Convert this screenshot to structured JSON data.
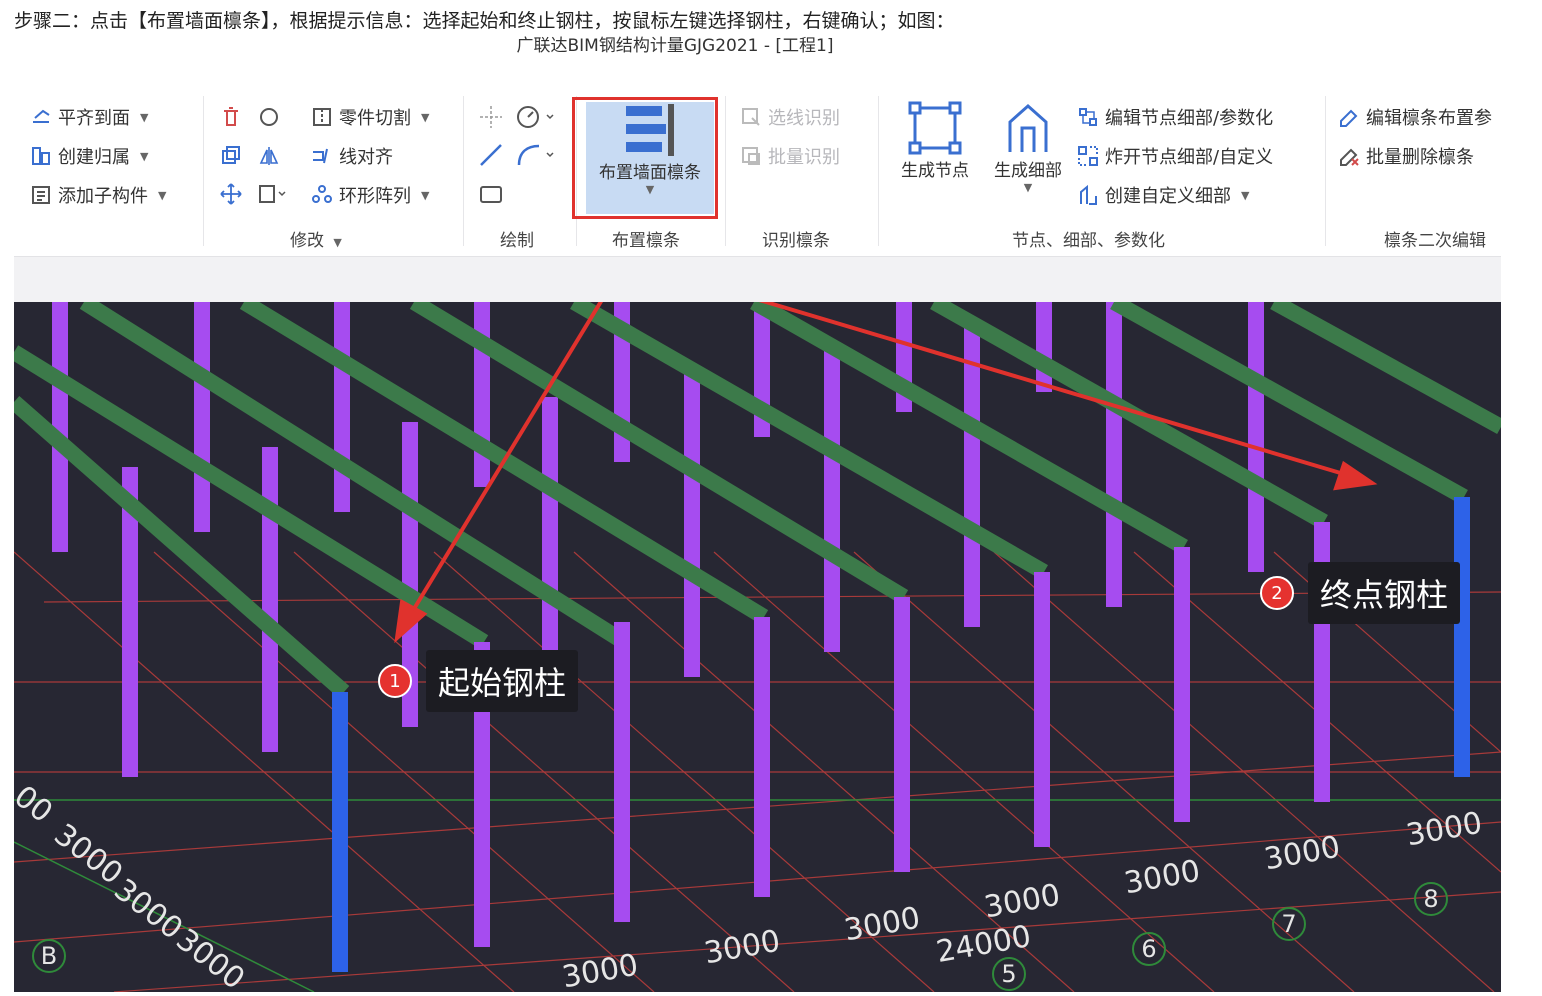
{
  "instruction": "步骤二：点击【布置墙面檩条】，根据提示信息：选择起始和终止钢柱，按鼠标左键选择钢柱，右键确认；如图：",
  "app_title": "广联达BIM钢结构计量GJG2021 - [工程1]",
  "ribbon": {
    "left_group": [
      "平齐到面",
      "创建归属",
      "添加子构件"
    ],
    "modify_group": {
      "cut": "零件切割",
      "align": "线对齐",
      "array": "环形阵列",
      "label": "修改"
    },
    "draw_label": "绘制",
    "place_purlin": {
      "label": "布置墙面檩条",
      "group_label": "布置檩条"
    },
    "recognize": {
      "line": "选线识别",
      "batch": "批量识别",
      "label": "识别檩条"
    },
    "node": {
      "gen_node": "生成节点",
      "gen_detail": "生成细部",
      "edit": "编辑节点细部/参数化",
      "explode": "炸开节点细部/自定义",
      "custom": "创建自定义细部",
      "label": "节点、细部、参数化"
    },
    "purlin_edit": {
      "edit": "编辑檩条布置参",
      "delete": "批量删除檩条",
      "label": "檩条二次编辑"
    }
  },
  "callouts": [
    {
      "num": "1",
      "text": "起始钢柱"
    },
    {
      "num": "2",
      "text": "终点钢柱"
    }
  ],
  "dimensions": {
    "left_column": [
      "00",
      "3000",
      "3000",
      "3000"
    ],
    "bottom_row": [
      "3000",
      "3000",
      "3000",
      "3000",
      "3000",
      "3000",
      "3000"
    ],
    "total": "24000"
  },
  "axes": {
    "b": "B",
    "n5": "5",
    "n6": "6",
    "n7": "7",
    "n8": "8"
  },
  "colors": {
    "highlight": "#e0322d",
    "column": "#a64cf0",
    "selected_column": "#2d62e8",
    "purlin": "#3c7a4a",
    "grid": "#b03a3a",
    "background": "#272733"
  }
}
